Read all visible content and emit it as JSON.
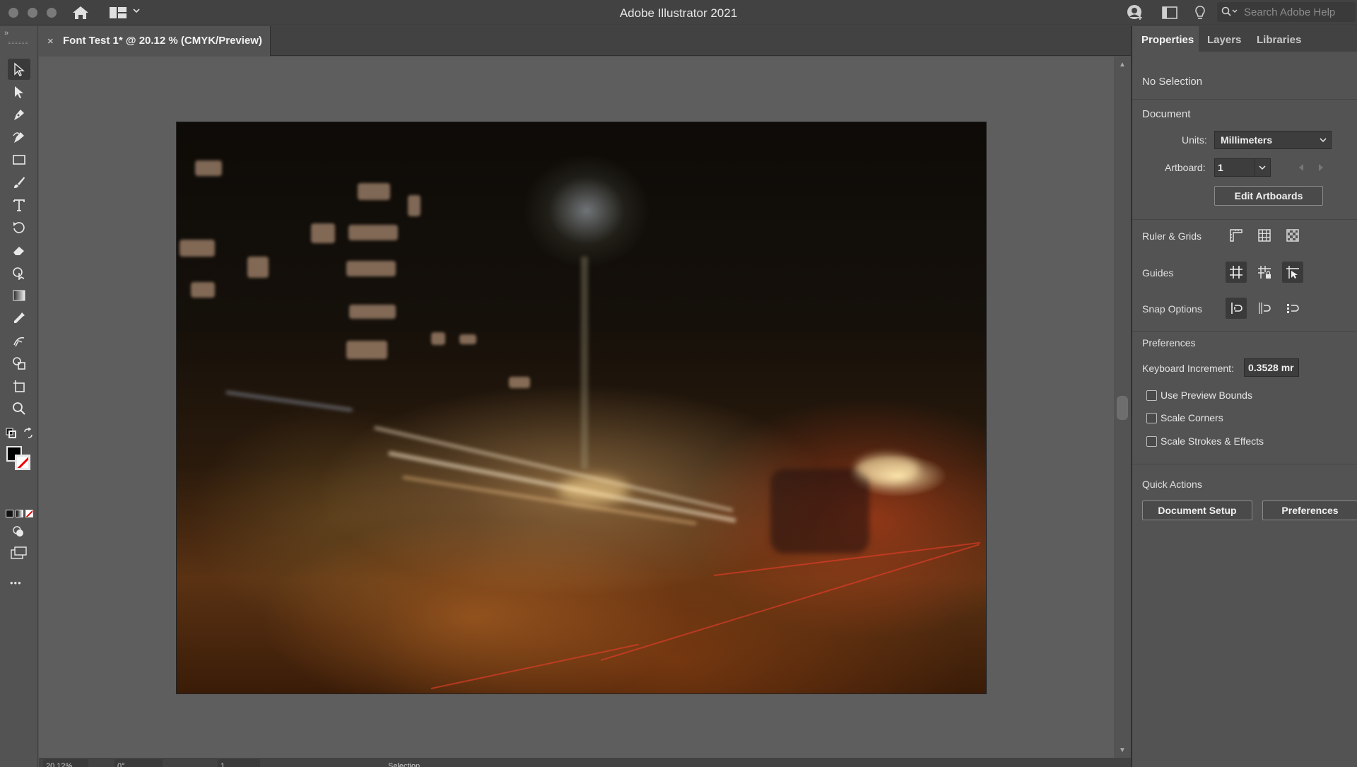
{
  "titlebar": {
    "app_title": "Adobe Illustrator 2021",
    "search_placeholder": "Search Adobe Help"
  },
  "document": {
    "tab_label": "Font Test 1* @ 20.12 % (CMYK/Preview)",
    "close_glyph": "×"
  },
  "toolbar": {
    "collapse_glyph": "»",
    "more_glyph": "•••"
  },
  "statusbar": {
    "zoom": "20.12%",
    "rotation": "0°",
    "artboard": "1",
    "tool": "Selection"
  },
  "panel": {
    "tabs": [
      "Properties",
      "Layers",
      "Libraries"
    ],
    "selection_label": "No Selection",
    "document_title": "Document",
    "units_label": "Units:",
    "units_value": "Millimeters",
    "artboard_label": "Artboard:",
    "artboard_value": "1",
    "edit_artboards": "Edit Artboards",
    "ruler_grids": "Ruler & Grids",
    "guides": "Guides",
    "snap_options": "Snap Options",
    "preferences_title": "Preferences",
    "keyboard_increment_label": "Keyboard Increment:",
    "keyboard_increment_value": "0.3528 mr",
    "checkboxes": [
      "Use Preview Bounds",
      "Scale Corners",
      "Scale Strokes & Effects"
    ],
    "quick_actions_title": "Quick Actions",
    "document_setup": "Document Setup",
    "preferences_button": "Preferences"
  },
  "colors": {
    "ui_dark": "#424242",
    "ui_mid": "#535353",
    "canvas": "#5e5e5e"
  }
}
